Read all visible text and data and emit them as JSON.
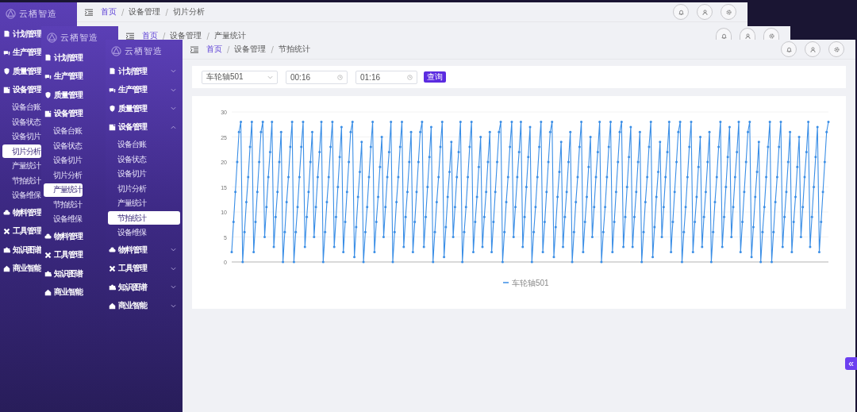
{
  "windows": [
    {
      "sidebar": {
        "logo": "云栖智造",
        "items": [
          {
            "label": "计划管理"
          },
          {
            "label": "生产管理"
          },
          {
            "label": "质量管理"
          },
          {
            "label": "设备管理",
            "children": [
              {
                "label": "设备台账",
                "selected": false
              },
              {
                "label": "设备状态",
                "selected": false
              },
              {
                "label": "设备切片",
                "selected": false
              },
              {
                "label": "切片分析",
                "selected": true
              },
              {
                "label": "产量统计",
                "selected": false
              },
              {
                "label": "节拍统计",
                "selected": false
              },
              {
                "label": "设备维保",
                "selected": false
              }
            ]
          },
          {
            "label": "物料管理"
          },
          {
            "label": "工具管理"
          },
          {
            "label": "知识图谱"
          },
          {
            "label": "商业智能"
          }
        ]
      },
      "breadcrumb": [
        {
          "label": "首页",
          "kind": "link"
        },
        {
          "label": "/",
          "kind": "sep"
        },
        {
          "label": "设备管理",
          "kind": "text"
        },
        {
          "label": "/",
          "kind": "sep"
        },
        {
          "label": "切片分析",
          "kind": "text"
        }
      ]
    },
    {
      "sidebar": {
        "logo": "云栖智造",
        "items": [
          {
            "label": "计划管理"
          },
          {
            "label": "生产管理"
          },
          {
            "label": "质量管理"
          },
          {
            "label": "设备管理",
            "children": [
              {
                "label": "设备台账",
                "selected": false
              },
              {
                "label": "设备状态",
                "selected": false
              },
              {
                "label": "设备切片",
                "selected": false
              },
              {
                "label": "切片分析",
                "selected": false
              },
              {
                "label": "产量统计",
                "selected": true
              },
              {
                "label": "节拍统计",
                "selected": false
              },
              {
                "label": "设备维保",
                "selected": false
              }
            ]
          },
          {
            "label": "物料管理"
          },
          {
            "label": "工具管理"
          },
          {
            "label": "知识图谱"
          },
          {
            "label": "商业智能"
          }
        ]
      },
      "breadcrumb": [
        {
          "label": "首页",
          "kind": "link"
        },
        {
          "label": "/",
          "kind": "sep"
        },
        {
          "label": "设备管理",
          "kind": "text"
        },
        {
          "label": "/",
          "kind": "sep"
        },
        {
          "label": "产量统计",
          "kind": "text"
        }
      ]
    },
    {
      "sidebar": {
        "logo": "云栖智造",
        "items": [
          {
            "label": "计划管理",
            "expanded": false
          },
          {
            "label": "生产管理",
            "expanded": false
          },
          {
            "label": "质量管理",
            "expanded": false
          },
          {
            "label": "设备管理",
            "expanded": true,
            "children": [
              {
                "label": "设备台账",
                "selected": false
              },
              {
                "label": "设备状态",
                "selected": false
              },
              {
                "label": "设备切片",
                "selected": false
              },
              {
                "label": "切片分析",
                "selected": false
              },
              {
                "label": "产量统计",
                "selected": false
              },
              {
                "label": "节拍统计",
                "selected": true
              },
              {
                "label": "设备维保",
                "selected": false
              }
            ]
          },
          {
            "label": "物料管理",
            "expanded": false
          },
          {
            "label": "工具管理",
            "expanded": false
          },
          {
            "label": "知识图谱",
            "expanded": false
          },
          {
            "label": "商业智能",
            "expanded": false
          }
        ]
      },
      "breadcrumb": [
        {
          "label": "首页",
          "kind": "link"
        },
        {
          "label": "/",
          "kind": "sep"
        },
        {
          "label": "设备管理",
          "kind": "text"
        },
        {
          "label": "/",
          "kind": "sep"
        },
        {
          "label": "节拍统计",
          "kind": "text"
        }
      ],
      "filters": {
        "device": "车轮轴501",
        "start_time": "00:16",
        "end_time": "01:16",
        "button": "查询"
      },
      "chart_data": {
        "type": "line",
        "grid": true,
        "ylim": [
          0,
          30
        ],
        "yticks": [
          0,
          5,
          10,
          15,
          20,
          25,
          30
        ],
        "series": [
          {
            "name": "车轮轴501",
            "color": "#3a8ee6",
            "values": [
              2,
              8,
              14,
              20,
              26,
              28,
              0,
              6,
              12,
              17,
              23,
              28,
              2,
              8,
              14,
              20,
              26,
              28,
              5,
              11,
              17,
              22,
              28,
              3,
              9,
              14,
              20,
              26,
              0,
              6,
              12,
              17,
              23,
              28,
              0,
              6,
              11,
              17,
              23,
              28,
              3,
              9,
              14,
              20,
              26,
              5,
              11,
              17,
              22,
              28,
              0,
              6,
              12,
              17,
              23,
              28,
              3,
              9,
              15,
              21,
              27,
              2,
              8,
              14,
              20,
              26,
              28,
              1,
              7,
              13,
              18,
              24,
              0,
              6,
              11,
              17,
              23,
              28,
              2,
              8,
              13,
              19,
              25,
              5,
              11,
              17,
              22,
              28,
              0,
              6,
              12,
              17,
              23,
              28,
              3,
              9,
              14,
              20,
              26,
              2,
              8,
              14,
              20,
              26,
              28,
              3,
              9,
              15,
              21,
              27,
              0,
              6,
              12,
              17,
              23,
              28,
              1,
              7,
              13,
              18,
              24,
              5,
              11,
              17,
              22,
              28,
              0,
              6,
              11,
              17,
              23,
              28,
              2,
              8,
              13,
              19,
              25,
              3,
              9,
              14,
              20,
              26,
              2,
              8,
              14,
              20,
              26,
              28,
              0,
              6,
              12,
              17,
              23,
              28,
              5,
              11,
              17,
              22,
              28,
              3,
              9,
              15,
              21,
              27,
              0,
              6,
              11,
              17,
              23,
              28,
              2,
              8,
              14,
              20,
              26,
              28,
              1,
              7,
              13,
              18,
              24,
              3,
              9,
              14,
              20,
              26,
              0,
              6,
              12,
              17,
              23,
              28,
              2,
              8,
              13,
              19,
              25,
              5,
              11,
              17,
              22,
              28,
              0,
              6,
              11,
              17,
              23,
              28,
              2,
              8,
              14,
              20,
              26,
              28,
              3,
              9,
              15,
              21,
              27,
              3,
              9,
              14,
              20,
              26,
              0,
              6,
              12,
              17,
              23,
              28,
              1,
              7,
              13,
              18,
              24,
              5,
              11,
              17,
              22,
              28,
              2,
              8,
              14,
              20,
              26,
              28,
              0,
              6,
              11,
              17,
              23,
              28,
              2,
              8,
              13,
              19,
              25,
              3,
              9,
              14,
              20,
              26,
              0,
              6,
              12,
              17,
              23,
              28,
              3,
              9,
              15,
              21,
              27,
              5,
              11,
              17,
              22,
              28,
              2,
              8,
              14,
              20,
              26,
              28,
              1,
              7,
              13,
              18,
              24,
              0,
              6,
              11,
              17,
              23,
              28,
              0,
              6,
              12,
              17,
              23,
              28,
              3,
              9,
              14,
              20,
              26,
              2,
              8,
              13,
              19,
              25,
              5,
              11,
              17,
              22,
              28,
              3,
              9,
              15,
              21,
              27,
              2,
              8,
              14,
              20,
              26,
              28
            ]
          }
        ]
      }
    }
  ],
  "collapse_button": "«"
}
